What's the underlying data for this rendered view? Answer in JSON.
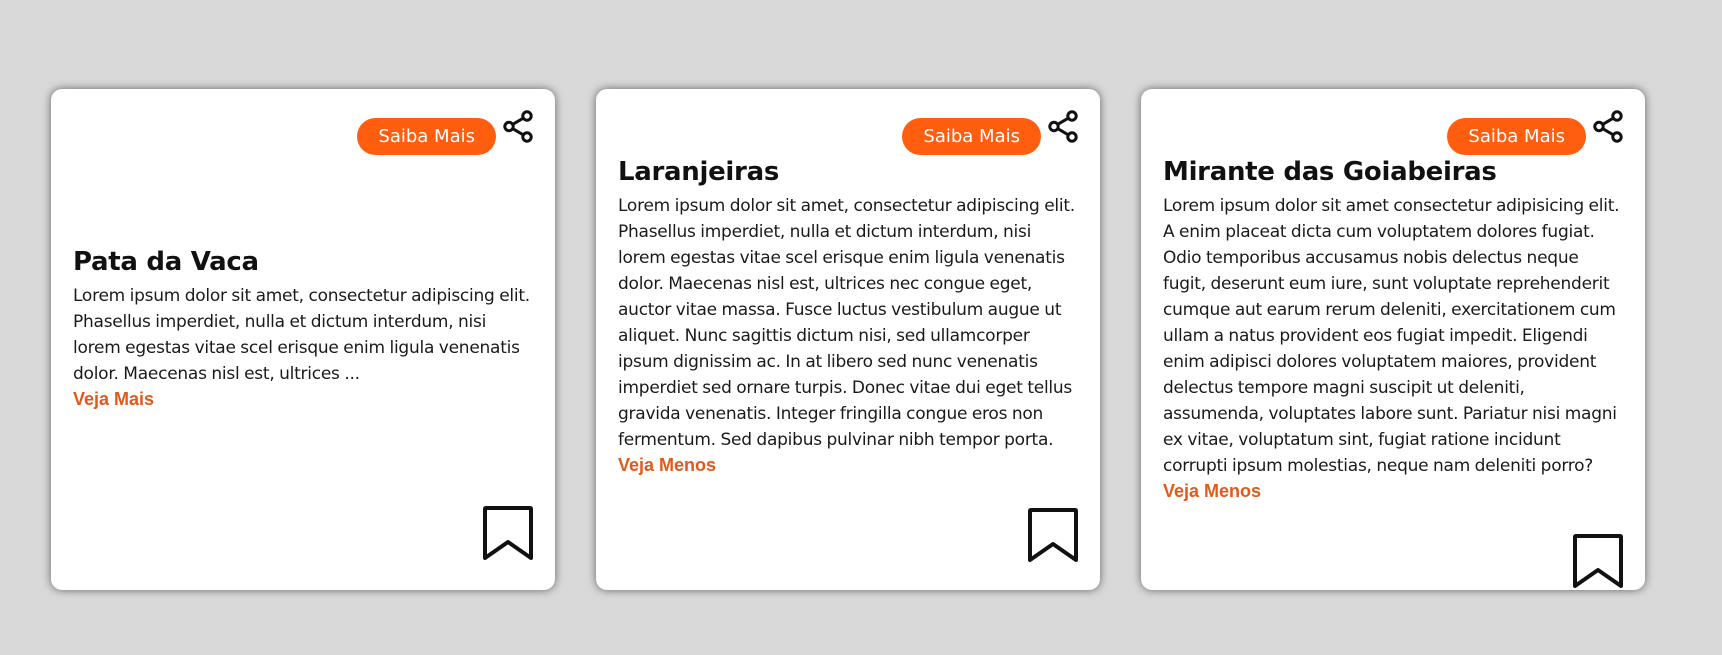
{
  "colors": {
    "page_background": "#d9d9d9",
    "card_background": "#ffffff",
    "accent": "#ff5e0e",
    "link": "#e05a1a",
    "text": "#111111"
  },
  "cards": [
    {
      "button_label": "Saiba Mais",
      "title": "Pata da Vaca",
      "text": "Lorem ipsum dolor sit amet, consectetur adipiscing elit. Phasellus imperdiet, nulla et dictum interdum, nisi lorem egestas vitae scel erisque enim ligula venenatis dolor. Maecenas nisl est, ultrices ...",
      "toggle_label": "Veja Mais",
      "share_icon": "share-icon",
      "bookmark_icon": "bookmark-icon"
    },
    {
      "button_label": "Saiba Mais",
      "title": "Laranjeiras",
      "text": "Lorem ipsum dolor sit amet, consectetur adipiscing elit. Phasellus imperdiet, nulla et dictum interdum, nisi lorem egestas vitae scel erisque enim ligula venenatis dolor. Maecenas nisl est, ultrices nec congue eget, auctor vitae massa. Fusce luctus vestibulum augue ut aliquet. Nunc sagittis dictum nisi, sed ullamcorper ipsum dignissim ac. In at libero sed nunc venenatis imperdiet sed ornare turpis. Donec vitae dui eget tellus gravida venenatis. Integer fringilla congue eros non fermentum. Sed dapibus pulvinar nibh tempor porta.",
      "toggle_label": "Veja Menos",
      "share_icon": "share-icon",
      "bookmark_icon": "bookmark-icon"
    },
    {
      "button_label": "Saiba Mais",
      "title": "Mirante das Goiabeiras",
      "text": "Lorem ipsum dolor sit amet consectetur adipisicing elit. A enim placeat dicta cum voluptatem dolores fugiat. Odio temporibus accusamus nobis delectus neque fugit, deserunt eum iure, sunt voluptate reprehenderit cumque aut earum rerum deleniti, exercitationem cum ullam a natus provident eos fugiat impedit. Eligendi enim adipisci dolores voluptatem maiores, provident delectus tempore magni suscipit ut deleniti, assumenda, voluptates labore sunt. Pariatur nisi magni ex vitae, voluptatum sint, fugiat ratione incidunt corrupti ipsum molestias, neque nam deleniti porro?",
      "toggle_label": "Veja Menos",
      "share_icon": "share-icon",
      "bookmark_icon": "bookmark-icon"
    }
  ]
}
